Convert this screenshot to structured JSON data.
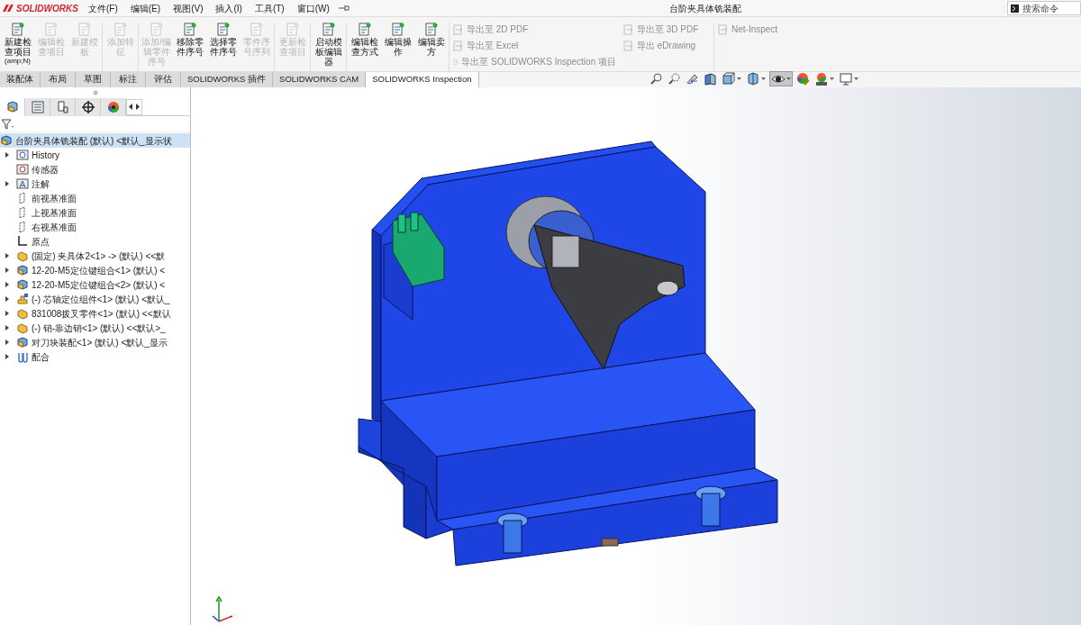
{
  "app": {
    "logo": "SOLIDWORKS",
    "title": "台阶夹具体铣装配",
    "search": {
      "placeholder": "搜索命令"
    }
  },
  "menu": [
    "文件(F)",
    "编辑(E)",
    "视图(V)",
    "插入(I)",
    "工具(T)",
    "窗口(W)"
  ],
  "ribbon": {
    "groups": [
      [
        {
          "label": "新建检查项目",
          "shortcut": "(amp;N)",
          "disabled": false
        },
        {
          "label": "编辑检查项目",
          "disabled": true
        },
        {
          "label": "新建模板",
          "disabled": true
        }
      ],
      [
        {
          "label": "添加特征",
          "disabled": true
        }
      ],
      [
        {
          "label": "添加/编辑零件序号",
          "disabled": true
        },
        {
          "label": "移除零件序号",
          "disabled": false
        },
        {
          "label": "选择零件序号",
          "disabled": false
        },
        {
          "label": "零件序号序列",
          "disabled": true
        }
      ],
      [
        {
          "label": "更新检查项目",
          "disabled": true
        }
      ],
      [
        {
          "label": "启动模板编辑器",
          "disabled": false
        }
      ],
      [
        {
          "label": "编辑检查方式",
          "disabled": false
        },
        {
          "label": "编辑操作",
          "disabled": false
        },
        {
          "label": "编辑卖方",
          "disabled": false
        }
      ]
    ],
    "exports": [
      [
        {
          "label": "导出至 2D PDF",
          "disabled": true
        },
        {
          "label": "导出至 Excel",
          "disabled": true
        },
        {
          "label": "导出至 SOLIDWORKS Inspection 项目",
          "disabled": true
        }
      ],
      [
        {
          "label": "导出至 3D PDF",
          "disabled": true
        },
        {
          "label": "导出 eDrawing",
          "disabled": true
        }
      ],
      [
        {
          "label": "Net-Inspect",
          "disabled": true
        }
      ]
    ]
  },
  "tabs": [
    {
      "label": "装配体",
      "selected": false
    },
    {
      "label": "布局",
      "selected": false
    },
    {
      "label": "草图",
      "selected": false
    },
    {
      "label": "标注",
      "selected": false
    },
    {
      "label": "评估",
      "selected": false
    },
    {
      "label": "SOLIDWORKS 插件",
      "selected": false
    },
    {
      "label": "SOLIDWORKS CAM",
      "selected": false
    },
    {
      "label": "SOLIDWORKS Inspection",
      "selected": true
    }
  ],
  "view_tools": [
    {
      "kind": "zoom",
      "selected": false,
      "dropdown": false
    },
    {
      "kind": "zoom-area",
      "selected": false,
      "dropdown": false
    },
    {
      "kind": "previous",
      "selected": false,
      "dropdown": false
    },
    {
      "kind": "section",
      "selected": false,
      "dropdown": false
    },
    {
      "kind": "orientation",
      "selected": false,
      "dropdown": true
    },
    {
      "kind": "display",
      "selected": false,
      "dropdown": true
    },
    {
      "kind": "hide-show",
      "selected": true,
      "dropdown": true
    },
    {
      "kind": "appearance",
      "selected": false,
      "dropdown": false
    },
    {
      "kind": "scene",
      "selected": false,
      "dropdown": true
    },
    {
      "kind": "monitor",
      "selected": false,
      "dropdown": true
    }
  ],
  "panel_tabs": [
    {
      "kind": "tree",
      "selected": true
    },
    {
      "kind": "properties",
      "selected": false
    },
    {
      "kind": "config",
      "selected": false
    },
    {
      "kind": "dimxpert",
      "selected": false
    },
    {
      "kind": "display",
      "selected": false
    }
  ],
  "tree": {
    "label": "台阶夹具体铣装配 (默认) <默认_显示状",
    "kind": "assembly",
    "selected": true,
    "children": [
      {
        "label": "History",
        "kind": "history",
        "expandable": true
      },
      {
        "label": "传感器",
        "kind": "sensor",
        "expandable": false
      },
      {
        "label": "注解",
        "kind": "annotation",
        "expandable": true
      },
      {
        "label": "前视基准面",
        "kind": "plane",
        "expandable": false
      },
      {
        "label": "上视基准面",
        "kind": "plane",
        "expandable": false
      },
      {
        "label": "右视基准面",
        "kind": "plane",
        "expandable": false
      },
      {
        "label": "原点",
        "kind": "origin",
        "expandable": false
      },
      {
        "label": "(固定) 夹具体2<1> -> (默认) <<默",
        "kind": "part",
        "expandable": true
      },
      {
        "label": "12-20-M5定位键组合<1> (默认) <",
        "kind": "assembly",
        "expandable": true
      },
      {
        "label": "12-20-M5定位键组合<2> (默认) <",
        "kind": "assembly",
        "expandable": true
      },
      {
        "label": "(-) 芯轴定位组件<1> (默认) <默认_",
        "kind": "flex-assembly",
        "expandable": true
      },
      {
        "label": "831008拨叉零件<1> (默认) <<默认",
        "kind": "part",
        "expandable": true
      },
      {
        "label": "(-) 销-靠边销<1> (默认) <<默认>_",
        "kind": "part",
        "expandable": true
      },
      {
        "label": "对刀块装配<1> (默认) <默认_显示",
        "kind": "assembly",
        "expandable": true
      },
      {
        "label": "配合",
        "kind": "mates",
        "expandable": true
      }
    ]
  }
}
